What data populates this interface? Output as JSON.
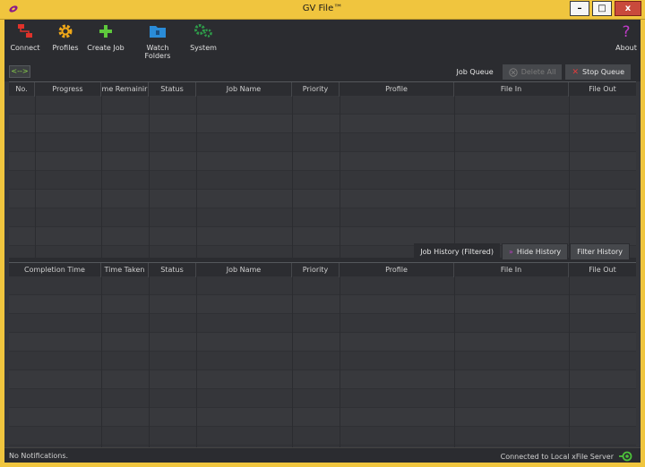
{
  "window": {
    "title": "GV File™",
    "minimize_glyph": "–",
    "maximize_glyph": "□",
    "close_glyph": "x"
  },
  "toolbar": {
    "connect": "Connect",
    "profiles": "Profiles",
    "create_job": "Create Job",
    "watch_folders": "Watch Folders",
    "system": "System",
    "about": "About"
  },
  "queue_bar": {
    "swap": "<-->",
    "label": "Job Queue",
    "delete_all": "Delete All",
    "stop_queue": "Stop Queue"
  },
  "queue_table": {
    "columns": [
      "No.",
      "Progress",
      "me Remainir",
      "Status",
      "Job Name",
      "Priority",
      "Profile",
      "File In",
      "File Out"
    ]
  },
  "history_bar": {
    "label": "Job History (Filtered)",
    "hide_history": "Hide History",
    "filter_history": "Filter History"
  },
  "history_table": {
    "columns": [
      "Completion Time",
      "Time Taken",
      "Status",
      "Job Name",
      "Priority",
      "Profile",
      "File In",
      "File Out"
    ]
  },
  "status": {
    "left": "No Notifications.",
    "right": "Connected to Local xFile Server"
  },
  "colors": {
    "accent": "#f0c53e",
    "background": "#35363a",
    "stop_red": "#e23c3c",
    "connected_green": "#4cc23a"
  }
}
